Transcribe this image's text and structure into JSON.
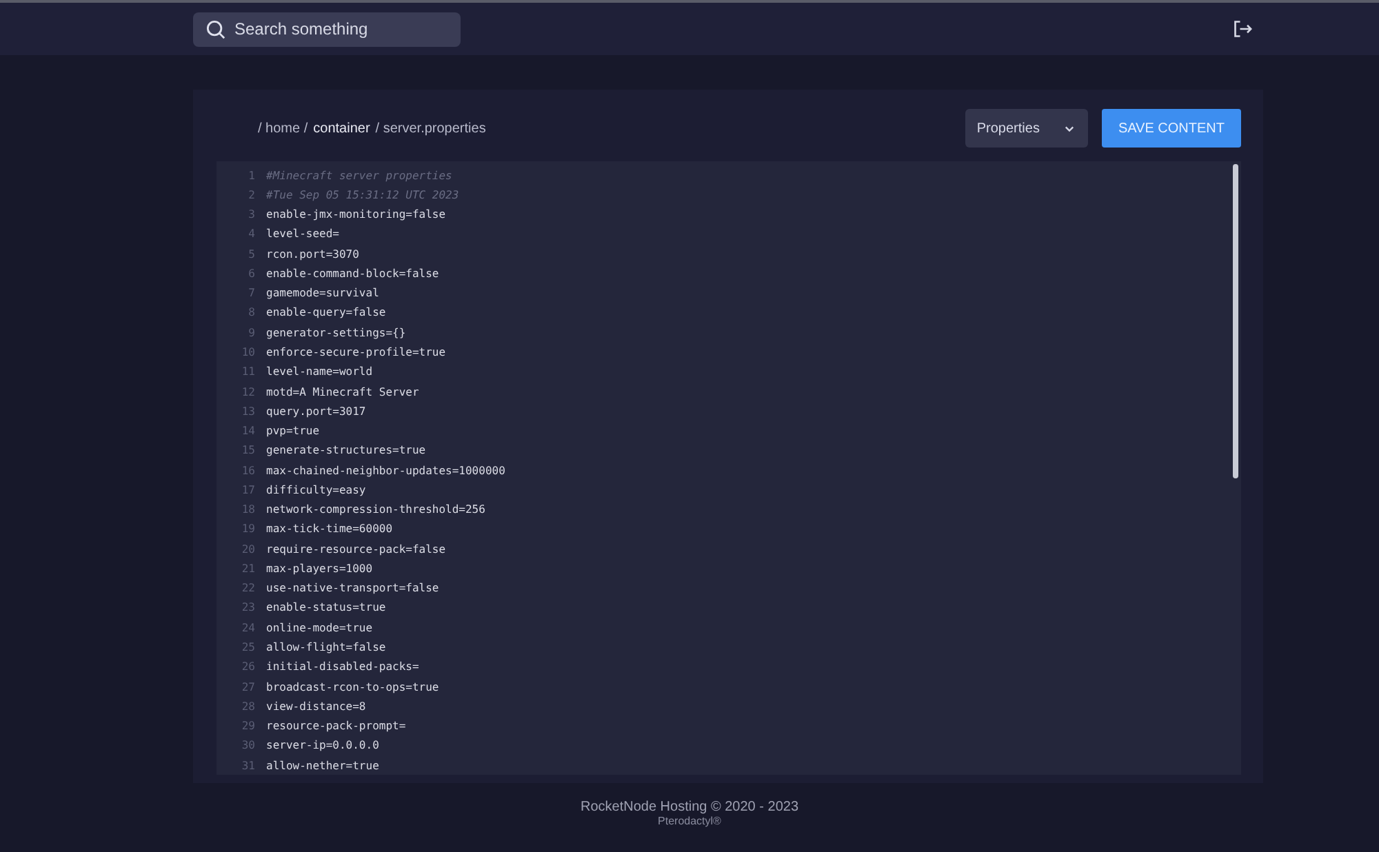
{
  "search": {
    "placeholder": "Search something"
  },
  "breadcrumb": [
    {
      "text": "/ home /",
      "kind": "plain"
    },
    {
      "text": "container",
      "kind": "strong"
    },
    {
      "text": "/ server.properties",
      "kind": "plain"
    }
  ],
  "file_type_select": {
    "value": "Properties"
  },
  "save_button": "SAVE CONTENT",
  "editor": {
    "lines": [
      {
        "number": "1",
        "text": "#Minecraft server properties",
        "kind": "comment"
      },
      {
        "number": "2",
        "text": "#Tue Sep 05 15:31:12 UTC 2023",
        "kind": "comment"
      },
      {
        "number": "3",
        "text": "enable-jmx-monitoring=false",
        "kind": "code"
      },
      {
        "number": "4",
        "text": "level-seed=",
        "kind": "code"
      },
      {
        "number": "5",
        "text": "rcon.port=3070",
        "kind": "code"
      },
      {
        "number": "6",
        "text": "enable-command-block=false",
        "kind": "code"
      },
      {
        "number": "7",
        "text": "gamemode=survival",
        "kind": "code"
      },
      {
        "number": "8",
        "text": "enable-query=false",
        "kind": "code"
      },
      {
        "number": "9",
        "text": "generator-settings={}",
        "kind": "code"
      },
      {
        "number": "10",
        "text": "enforce-secure-profile=true",
        "kind": "code"
      },
      {
        "number": "11",
        "text": "level-name=world",
        "kind": "code"
      },
      {
        "number": "12",
        "text": "motd=A Minecraft Server",
        "kind": "code"
      },
      {
        "number": "13",
        "text": "query.port=3017",
        "kind": "code"
      },
      {
        "number": "14",
        "text": "pvp=true",
        "kind": "code"
      },
      {
        "number": "15",
        "text": "generate-structures=true",
        "kind": "code"
      },
      {
        "number": "16",
        "text": "max-chained-neighbor-updates=1000000",
        "kind": "code"
      },
      {
        "number": "17",
        "text": "difficulty=easy",
        "kind": "code"
      },
      {
        "number": "18",
        "text": "network-compression-threshold=256",
        "kind": "code"
      },
      {
        "number": "19",
        "text": "max-tick-time=60000",
        "kind": "code"
      },
      {
        "number": "20",
        "text": "require-resource-pack=false",
        "kind": "code"
      },
      {
        "number": "21",
        "text": "max-players=1000",
        "kind": "code"
      },
      {
        "number": "22",
        "text": "use-native-transport=false",
        "kind": "code"
      },
      {
        "number": "23",
        "text": "enable-status=true",
        "kind": "code"
      },
      {
        "number": "24",
        "text": "online-mode=true",
        "kind": "code"
      },
      {
        "number": "25",
        "text": "allow-flight=false",
        "kind": "code"
      },
      {
        "number": "26",
        "text": "initial-disabled-packs=",
        "kind": "code"
      },
      {
        "number": "27",
        "text": "broadcast-rcon-to-ops=true",
        "kind": "code"
      },
      {
        "number": "28",
        "text": "view-distance=8",
        "kind": "code"
      },
      {
        "number": "29",
        "text": "resource-pack-prompt=",
        "kind": "code"
      },
      {
        "number": "30",
        "text": "server-ip=0.0.0.0",
        "kind": "code"
      },
      {
        "number": "31",
        "text": "allow-nether=true",
        "kind": "code"
      }
    ]
  },
  "footer": {
    "copyright": "RocketNode Hosting © 2020 - 2023",
    "credit": "Pterodactyl®"
  }
}
